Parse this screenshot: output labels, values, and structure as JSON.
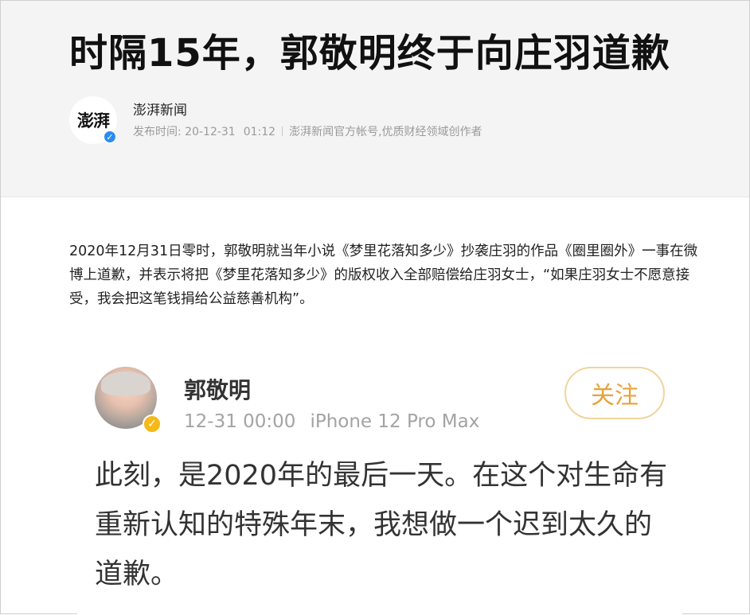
{
  "article": {
    "title": "时隔15年，郭敬明终于向庄羽道歉",
    "author": {
      "name": "澎湃新闻",
      "avatar_text": "澎湃",
      "verified_icon": "blue-check"
    },
    "meta": {
      "publish_label": "发布时间: 20-12-31",
      "publish_time": "01:12",
      "description": "澎湃新闻官方帐号,优质财经领域创作者"
    },
    "lead": "2020年12月31日零时，郭敬明就当年小说《梦里花落知多少》抄袭庄羽的作品《圈里圈外》一事在微博上道歉，并表示将把《梦里花落知多少》的版权收入全部赔偿给庄羽女士，“如果庄羽女士不愿意接受，我会把这笔钱捐给公益慈善机构”。"
  },
  "embedded_post": {
    "user_name": "郭敬明",
    "timestamp": "12-31 00:00",
    "device": "iPhone 12 Pro Max",
    "follow_label": "关注",
    "text": "此刻，是2020年的最后一天。在这个对生命有重新认知的特殊年末，我想做一个迟到太久的道歉。",
    "colors": {
      "follow_accent": "#e8a33c",
      "verified_badge": "#f5b918"
    }
  }
}
